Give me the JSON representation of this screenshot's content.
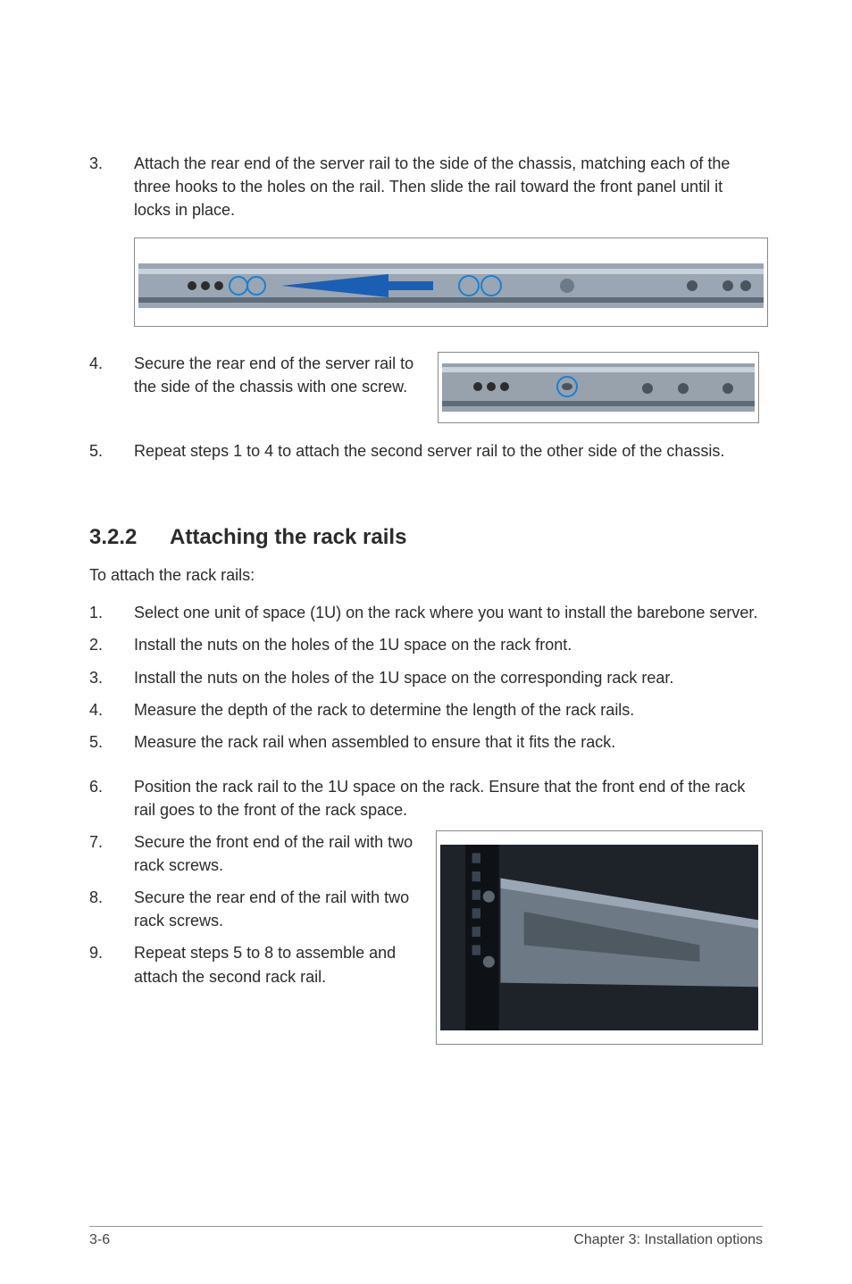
{
  "steps_top": [
    {
      "num": "3.",
      "text": "Attach the rear end of the server rail to the side of the chassis, matching each of the three hooks to the holes on the rail. Then slide the rail toward the front panel until it locks in place."
    },
    {
      "num": "4.",
      "text": "Secure the rear end of the server rail to the side of the chassis with one screw."
    },
    {
      "num": "5.",
      "text": "Repeat steps 1 to 4 to attach the second server rail to the other side of the chassis."
    }
  ],
  "section": {
    "num": "3.2.2",
    "title": "Attaching the rack rails"
  },
  "intro": "To attach the rack rails:",
  "steps_bottom": [
    {
      "num": "1.",
      "text": "Select one unit of space (1U) on the rack where you want to install the barebone server."
    },
    {
      "num": "2.",
      "text": "Install the nuts on the holes of the 1U space on the rack front."
    },
    {
      "num": "3.",
      "text": "Install the nuts on the holes of the 1U space on the corresponding rack rear."
    },
    {
      "num": "4.",
      "text": "Measure the depth of the rack to determine the length of the rack rails."
    },
    {
      "num": "5.",
      "text": "Measure the rack rail when assembled to ensure that it fits the rack."
    },
    {
      "num": "6.",
      "text": "Position the rack rail to the 1U space on the rack. Ensure that the front end of the rack rail goes to the front of the rack space."
    },
    {
      "num": "7.",
      "text": "Secure the front end of the rail with two rack screws."
    },
    {
      "num": "8.",
      "text": "Secure the rear end of the rail with two rack screws."
    },
    {
      "num": "9.",
      "text": "Repeat steps 5 to 8 to assemble and attach the second rack rail."
    }
  ],
  "footer": {
    "left": "3-6",
    "right": "Chapter 3:  Installation options"
  }
}
